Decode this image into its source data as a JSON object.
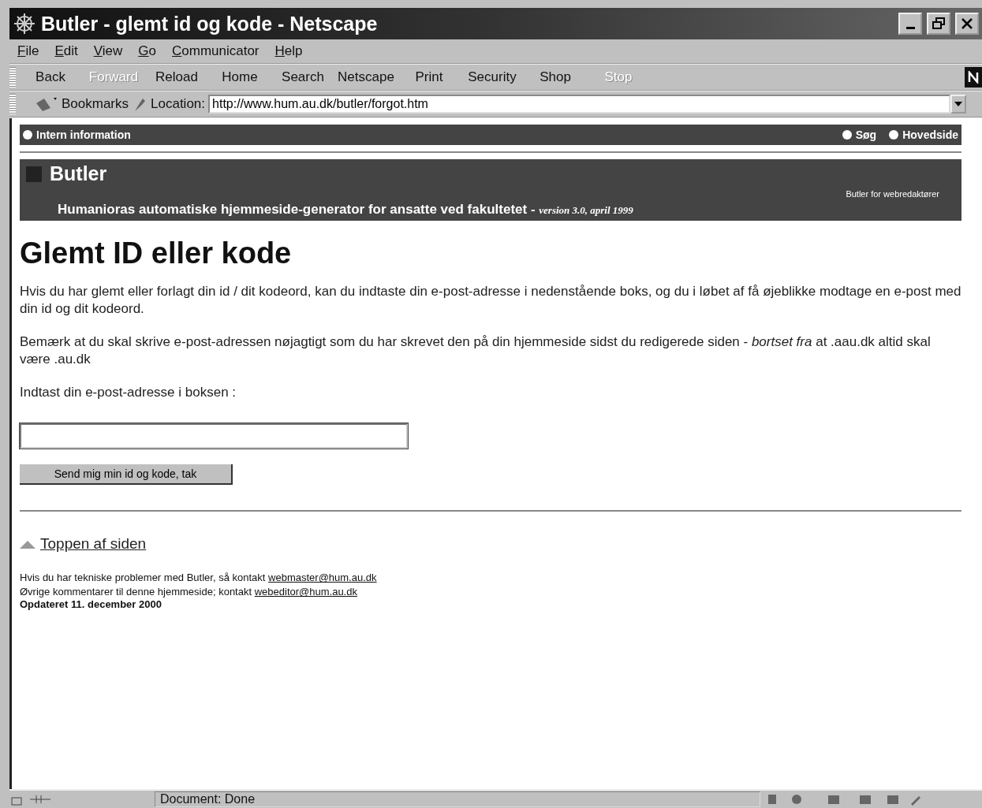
{
  "window": {
    "title": "Butler - glemt id og kode - Netscape"
  },
  "menu": [
    "File",
    "Edit",
    "View",
    "Go",
    "Communicator",
    "Help"
  ],
  "toolbar": [
    {
      "label": "Back",
      "disabled": false
    },
    {
      "label": "Forward",
      "disabled": true
    },
    {
      "label": "Reload",
      "disabled": false
    },
    {
      "label": "Home",
      "disabled": false
    },
    {
      "label": "Search",
      "disabled": false
    },
    {
      "label": "Netscape",
      "disabled": false
    },
    {
      "label": "Print",
      "disabled": false
    },
    {
      "label": "Security",
      "disabled": false
    },
    {
      "label": "Shop",
      "disabled": false
    },
    {
      "label": "Stop",
      "disabled": true
    }
  ],
  "location_bar": {
    "bookmarks": "Bookmarks",
    "label": "Location:",
    "url": "http://www.hum.au.dk/butler/forgot.htm"
  },
  "page": {
    "topnav": {
      "left": [
        "Intern information"
      ],
      "right": [
        "Søg",
        "Hovedside"
      ]
    },
    "banner": {
      "title": "Butler",
      "subtitle": "Humanioras automatiske hjemmeside-generator for ansatte ved fakultetet - ",
      "version": "version 3.0,  april 1999",
      "link": "Butler for webredaktører"
    },
    "heading": "Glemt ID eller kode",
    "paragraphs": [
      "Hvis du har glemt eller forlagt din id / dit kodeord, kan du indtaste din e-post-adresse i nedenstående boks, og du i løbet af få øjeblikke modtage en e-post med din id og dit kodeord.",
      "Bemærk at du skal skrive e-post-adressen nøjagtigt som du har skrevet den på din hjemmeside sidst du redigerede siden - *bortset fra* at .aau.dk altid skal være .au.dk",
      "Indtast din e-post-adresse i boksen :"
    ],
    "submit": "Send mig min id og kode, tak",
    "top_link": "Toppen af siden",
    "footer": [
      {
        "text": "Hvis du har tekniske problemer med Butler, så kontakt ",
        "link": "webmaster@hum.au.dk"
      },
      {
        "text": "Øvrige kommentarer til denne hjemmeside; kontakt ",
        "link": "webeditor@hum.au.dk"
      }
    ],
    "updated": "Opdateret 11. december 2000"
  },
  "status_bar": {
    "text": "Document: Done"
  }
}
